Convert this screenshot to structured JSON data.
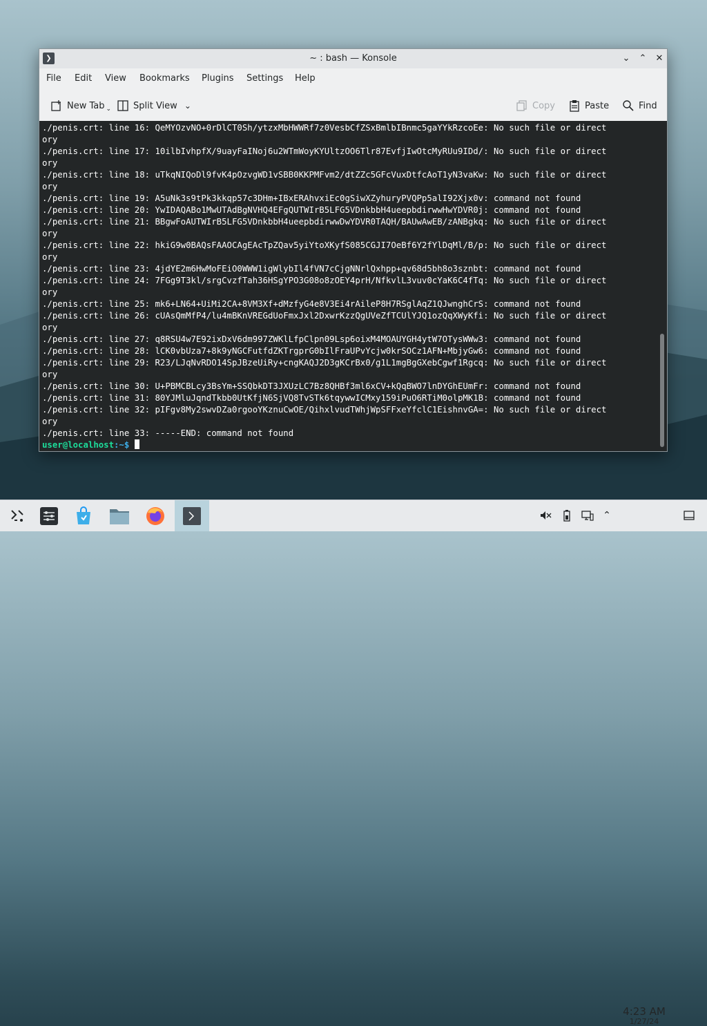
{
  "window": {
    "title": "~ : bash — Konsole",
    "controls": [
      "minimize",
      "maximize",
      "close"
    ]
  },
  "menubar": {
    "items": [
      "File",
      "Edit",
      "View",
      "Bookmarks",
      "Plugins",
      "Settings",
      "Help"
    ]
  },
  "toolbar": {
    "new_tab": "New Tab",
    "split_view": "Split View",
    "copy": "Copy",
    "paste": "Paste",
    "find": "Find"
  },
  "terminal": {
    "lines": [
      "./penis.crt: line 16: QeMYOzvNO+0rDlCT0Sh/ytzxMbHWWRf7z0VesbCfZSxBmlbIBnmc5gaYYkRzcoEe: No such file or direct",
      "ory",
      "./penis.crt: line 17: 10ilbIvhpfX/9uayFaINoj6u2WTmWoyKYUltzOO6Tlr87EvfjIwOtcMyRUu9IDd/: No such file or direct",
      "ory",
      "./penis.crt: line 18: uTkqNIQoDl9fvK4pOzvgWD1vSBB0KKPMFvm2/dtZZc5GFcVuxDtfcAoT1yN3vaKw: No such file or direct",
      "ory",
      "./penis.crt: line 19: A5uNk3s9tPk3kkqp57c3DHm+IBxERAhvxiEc0gSiwXZyhuryPVQPp5alI92Xjx0v: command not found",
      "./penis.crt: line 20: YwIDAQABo1MwUTAdBgNVHQ4EFgQUTWIrB5LFG5VDnkbbH4ueepbdirwwHwYDVR0j: command not found",
      "./penis.crt: line 21: BBgwFoAUTWIrB5LFG5VDnkbbH4ueepbdirwwDwYDVR0TAQH/BAUwAwEB/zANBgkq: No such file or direct",
      "ory",
      "./penis.crt: line 22: hkiG9w0BAQsFAAOCAgEAcTpZQav5yiYtoXKyfS085CGJI7OeBf6Y2fYlDqMl/B/p: No such file or direct",
      "ory",
      "./penis.crt: line 23: 4jdYE2m6HwMoFEiO0WWW1igWlybIl4fVN7cCjgNNrlQxhpp+qv68d5bh8o3sznbt: command not found",
      "./penis.crt: line 24: 7FGg9T3kl/srgCvzfTah36HSgYPO3G08o8zOEY4prH/NfkvlL3vuv0cYaK6C4fTq: No such file or direct",
      "ory",
      "./penis.crt: line 25: mk6+LN64+UiMi2CA+8VM3Xf+dMzfyG4e8V3Ei4rAileP8H7RSglAqZ1QJwnghCrS: command not found",
      "./penis.crt: line 26: cUAsQmMfP4/lu4mBKnVREGdUoFmxJxl2DxwrKzzQgUVeZfTCUlYJQ1ozQqXWyKfi: No such file or direct",
      "ory",
      "./penis.crt: line 27: q8RSU4w7E92ixDxV6dm997ZWKlLfpClpn09Lsp6oixM4MOAUYGH4ytW7OTysWWw3: command not found",
      "./penis.crt: line 28: lCK0vbUza7+8k9yNGCFutfdZKTrgprG0bIlFraUPvYcjw0krSOCz1AFN+MbjyGw6: command not found",
      "./penis.crt: line 29: R23/LJqNvRDO14SpJBzeUiRy+cngKAQJ2D3gKCrBx0/g1L1mgBgGXebCgwf1Rgcq: No such file or direct",
      "ory",
      "./penis.crt: line 30: U+PBMCBLcy3BsYm+SSQbkDT3JXUzLC7Bz8QHBf3ml6xCV+kQqBWO7lnDYGhEUmFr: command not found",
      "./penis.crt: line 31: 80YJMluJqndTkbb0UtKfjN6SjVQ8TvSTk6tqywwICMxy159iPuO6RTiM0olpMK1B: command not found",
      "./penis.crt: line 32: pIFgv8My2swvDZa0rgooYKznuCwOE/QihxlvudTWhjWpSFFxeYfclC1EishnvGA=: No such file or direct",
      "ory",
      "./penis.crt: line 33: -----END: command not found"
    ],
    "prompt_user": "user@localhost",
    "prompt_path": ":~$ "
  },
  "taskbar": {
    "launchers": [
      "application-launcher-icon",
      "system-settings-icon",
      "discover-store-icon",
      "file-manager-icon",
      "firefox-icon",
      "konsole-icon"
    ],
    "clock_time": "4:23 AM",
    "clock_date": "1/27/24",
    "tray": [
      "audio-muted-icon",
      "battery-icon",
      "network-icon",
      "tray-expand-icon",
      "show-desktop-icon"
    ]
  },
  "colors": {
    "terminal_bg": "#232627",
    "terminal_fg": "#fcfcfc",
    "prompt_user": "#1cdc9a",
    "prompt_path": "#3daee9",
    "active_task": "#b9d3dd"
  }
}
